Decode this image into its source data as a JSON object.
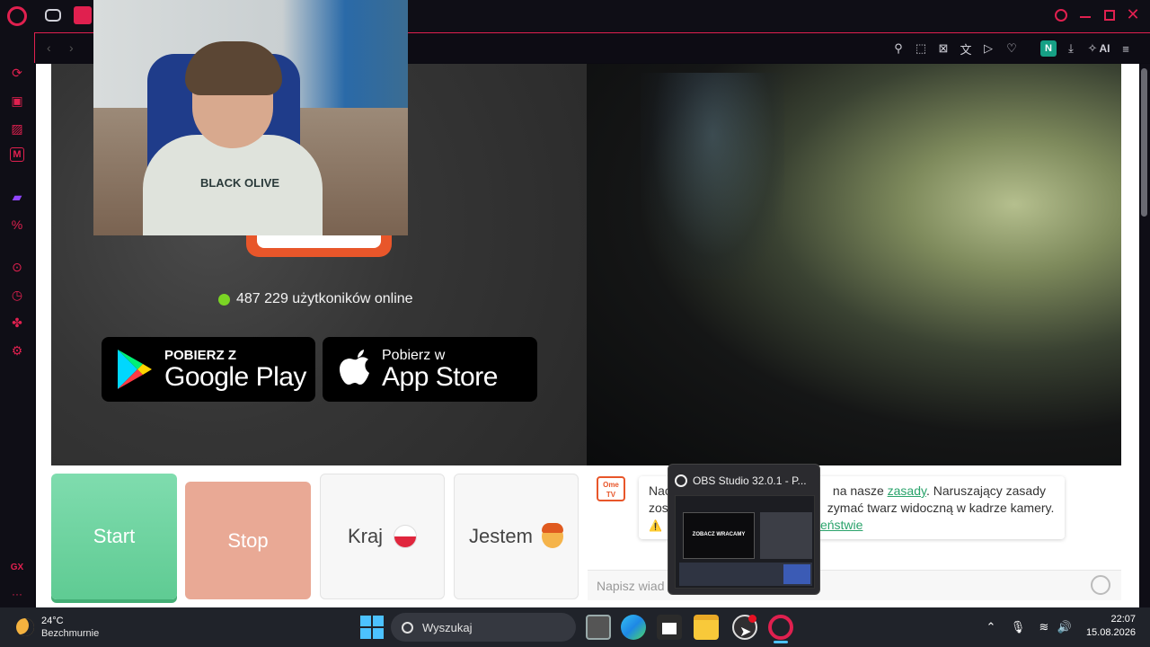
{
  "browser": {
    "name": "Opera GX",
    "accent_color": "#e0204f",
    "titlebar_icons": [
      "opera-gx-logo-icon",
      "gamepad-icon",
      "tab-favicon-icon"
    ],
    "window_controls": [
      "search-icon",
      "minimize-icon",
      "maximize-icon",
      "close-icon"
    ],
    "sidebar_icons": [
      "speed-dial-icon",
      "bag-icon",
      "gx-corner-icon",
      "messenger-m-icon",
      "twitch-icon",
      "discount-icon",
      "player-icon",
      "history-icon",
      "extensions-icon",
      "settings-icon"
    ],
    "sidebar_bottom": {
      "gx_label": "GX",
      "more_label": "···"
    },
    "toolbar": {
      "ai_label": "AI",
      "n_badge": "N",
      "icons": [
        "pin-icon",
        "snapshot-icon",
        "adblock-icon",
        "translate-icon",
        "play-icon",
        "heart-icon",
        "n-extension-icon",
        "download-icon",
        "aria-ai-icon",
        "menu-icon"
      ]
    }
  },
  "page": {
    "online_text": "487 229 użytkoników online",
    "online_dot_color": "#7bd424",
    "google_play": {
      "small": "POBIERZ Z",
      "big": "Google Play"
    },
    "app_store": {
      "small": "Pobierz w",
      "big": "App Store"
    },
    "webcam_shirt_text": "BLACK OLIVE",
    "controls": {
      "start_label": "Start",
      "stop_label": "Stop",
      "country_label": "Kraj",
      "gender_label": "Jestem"
    },
    "chat": {
      "logo_text": "Ome TV",
      "message_line1_prefix": "Nac",
      "message_line1_visible": "na nasze",
      "link_rules": "zasady",
      "message_line1_suffix": ". Naruszający zasady",
      "message_line2_prefix": "zos",
      "message_line2_visible": "zymać twarz widoczną w kadrze kamery.",
      "message_line3_link": "eństwie",
      "warning_icon": "⚠️",
      "input_placeholder": "Napisz wiad"
    }
  },
  "obs_popup": {
    "title": "OBS Studio 32.0.1 - P...",
    "thumb_caption": "ZOBACZ WRACAMY"
  },
  "taskbar": {
    "weather_temp": "24°C",
    "weather_desc": "Bezchmurnie",
    "search_placeholder": "Wyszukaj",
    "apps": [
      "windows-start-icon",
      "task-view-icon",
      "edge-icon",
      "store-icon",
      "file-explorer-icon",
      "obs-taskbar-icon",
      "opera-taskbar-icon"
    ],
    "tray_icons": [
      "chevron-up-icon",
      "microphone-icon",
      "wifi-icon",
      "volume-icon"
    ],
    "time": "22:07",
    "date": "15.08.2026"
  }
}
